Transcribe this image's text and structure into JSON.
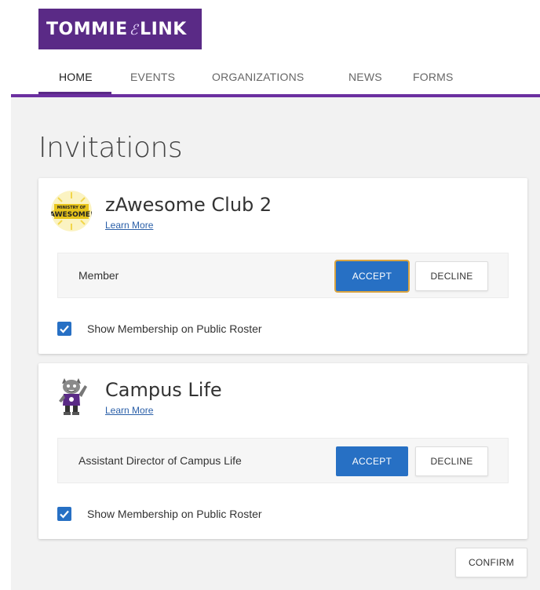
{
  "brand": {
    "logo_left": "TOMMIE",
    "logo_mid": "ℰ",
    "logo_right": "LINK",
    "color": "#5a2a86"
  },
  "nav": {
    "items": [
      {
        "label": "HOME",
        "active": true
      },
      {
        "label": "EVENTS",
        "active": false
      },
      {
        "label": "ORGANIZATIONS",
        "active": false
      },
      {
        "label": "NEWS",
        "active": false
      },
      {
        "label": "FORMS",
        "active": false
      }
    ]
  },
  "page": {
    "title": "Invitations"
  },
  "invitations": [
    {
      "org_name": "zAwesome Club 2",
      "learn_more": "Learn More",
      "avatar_icon": "ministry-of-awesome-logo",
      "avatar_text_small": "MINISTRY OF",
      "avatar_text_big": "AWESOME!",
      "role": "Member",
      "accept_label": "ACCEPT",
      "decline_label": "DECLINE",
      "roster_label": "Show Membership on Public Roster",
      "roster_checked": true
    },
    {
      "org_name": "Campus Life",
      "learn_more": "Learn More",
      "avatar_icon": "tommie-mascot-icon",
      "role": "Assistant Director of Campus Life",
      "accept_label": "ACCEPT",
      "decline_label": "DECLINE",
      "roster_label": "Show Membership on Public Roster",
      "roster_checked": true
    }
  ],
  "footer": {
    "confirm_label": "CONFIRM"
  },
  "colors": {
    "accent": "#2770c4",
    "nav_rule": "#6b2fa0",
    "background": "#f2f2f2"
  }
}
